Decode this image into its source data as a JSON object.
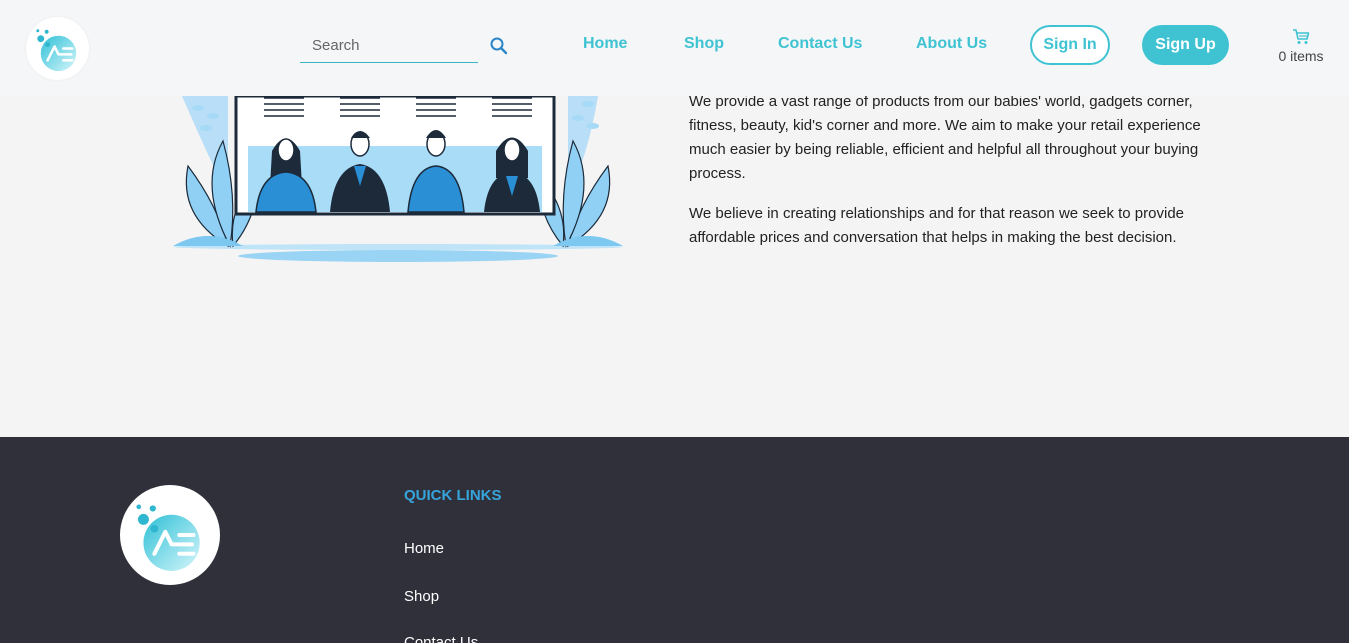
{
  "header": {
    "logo": {
      "icon": "ae-logo-icon"
    },
    "search": {
      "placeholder": "Search",
      "value": "",
      "icon": "search-icon"
    },
    "nav": {
      "home": "Home",
      "shop": "Shop",
      "contact": "Contact Us",
      "about": "About Us"
    },
    "auth": {
      "signin": "Sign In",
      "signup": "Sign Up"
    },
    "cart": {
      "icon": "cart-icon",
      "count_label": "0 items"
    }
  },
  "main": {
    "illustration": "team-meeting-illustration",
    "paragraphs": [
      "We provide a vast range of products from our babies' world, gadgets corner, fitness, beauty, kid's corner and more. We aim to make your retail experience much easier by being reliable, efficient and helpful all throughout your buying process.",
      "We believe in creating relationships and for that reason we seek to provide affordable prices and conversation that helps in making the best decision."
    ]
  },
  "footer": {
    "logo": {
      "icon": "ae-logo-icon"
    },
    "quick_links": {
      "title": "QUICK LINKS",
      "links": [
        "Home",
        "Shop",
        "Contact Us"
      ]
    }
  },
  "colors": {
    "accent": "#3fc3d2",
    "footer_bg": "#30303b",
    "footer_title": "#36a5dc",
    "page_bg": "#f4f4f4",
    "header_bg": "#f4f6f8"
  }
}
